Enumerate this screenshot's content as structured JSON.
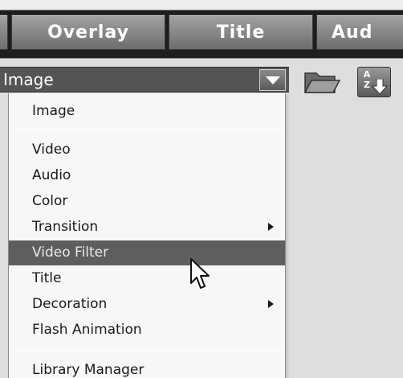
{
  "tabs": {
    "items": [
      {
        "label": "Overlay"
      },
      {
        "label": "Title"
      },
      {
        "label": "Aud"
      }
    ]
  },
  "library": {
    "combo_value": "Image",
    "toolbar": {
      "open_folder_icon": "folder-open-icon",
      "sort_icon": "sort-az-icon",
      "sort_letters": [
        "A",
        "Z"
      ]
    }
  },
  "menu": {
    "items": [
      {
        "label": "Image",
        "has_submenu": false,
        "selected": false
      },
      {
        "label": "Video",
        "has_submenu": false,
        "selected": false
      },
      {
        "label": "Audio",
        "has_submenu": false,
        "selected": false
      },
      {
        "label": "Color",
        "has_submenu": false,
        "selected": false
      },
      {
        "label": "Transition",
        "has_submenu": true,
        "selected": false
      },
      {
        "label": "Video Filter",
        "has_submenu": false,
        "selected": true
      },
      {
        "label": "Title",
        "has_submenu": false,
        "selected": false
      },
      {
        "label": "Decoration",
        "has_submenu": true,
        "selected": false
      },
      {
        "label": "Flash Animation",
        "has_submenu": false,
        "selected": false
      },
      {
        "label": "Library Manager",
        "has_submenu": false,
        "selected": false
      }
    ]
  },
  "colors": {
    "tab_bar": "#1e1e1e",
    "combo_background": "#555555",
    "menu_background": "#f7f7f7",
    "menu_highlight": "#5e5e5e"
  }
}
